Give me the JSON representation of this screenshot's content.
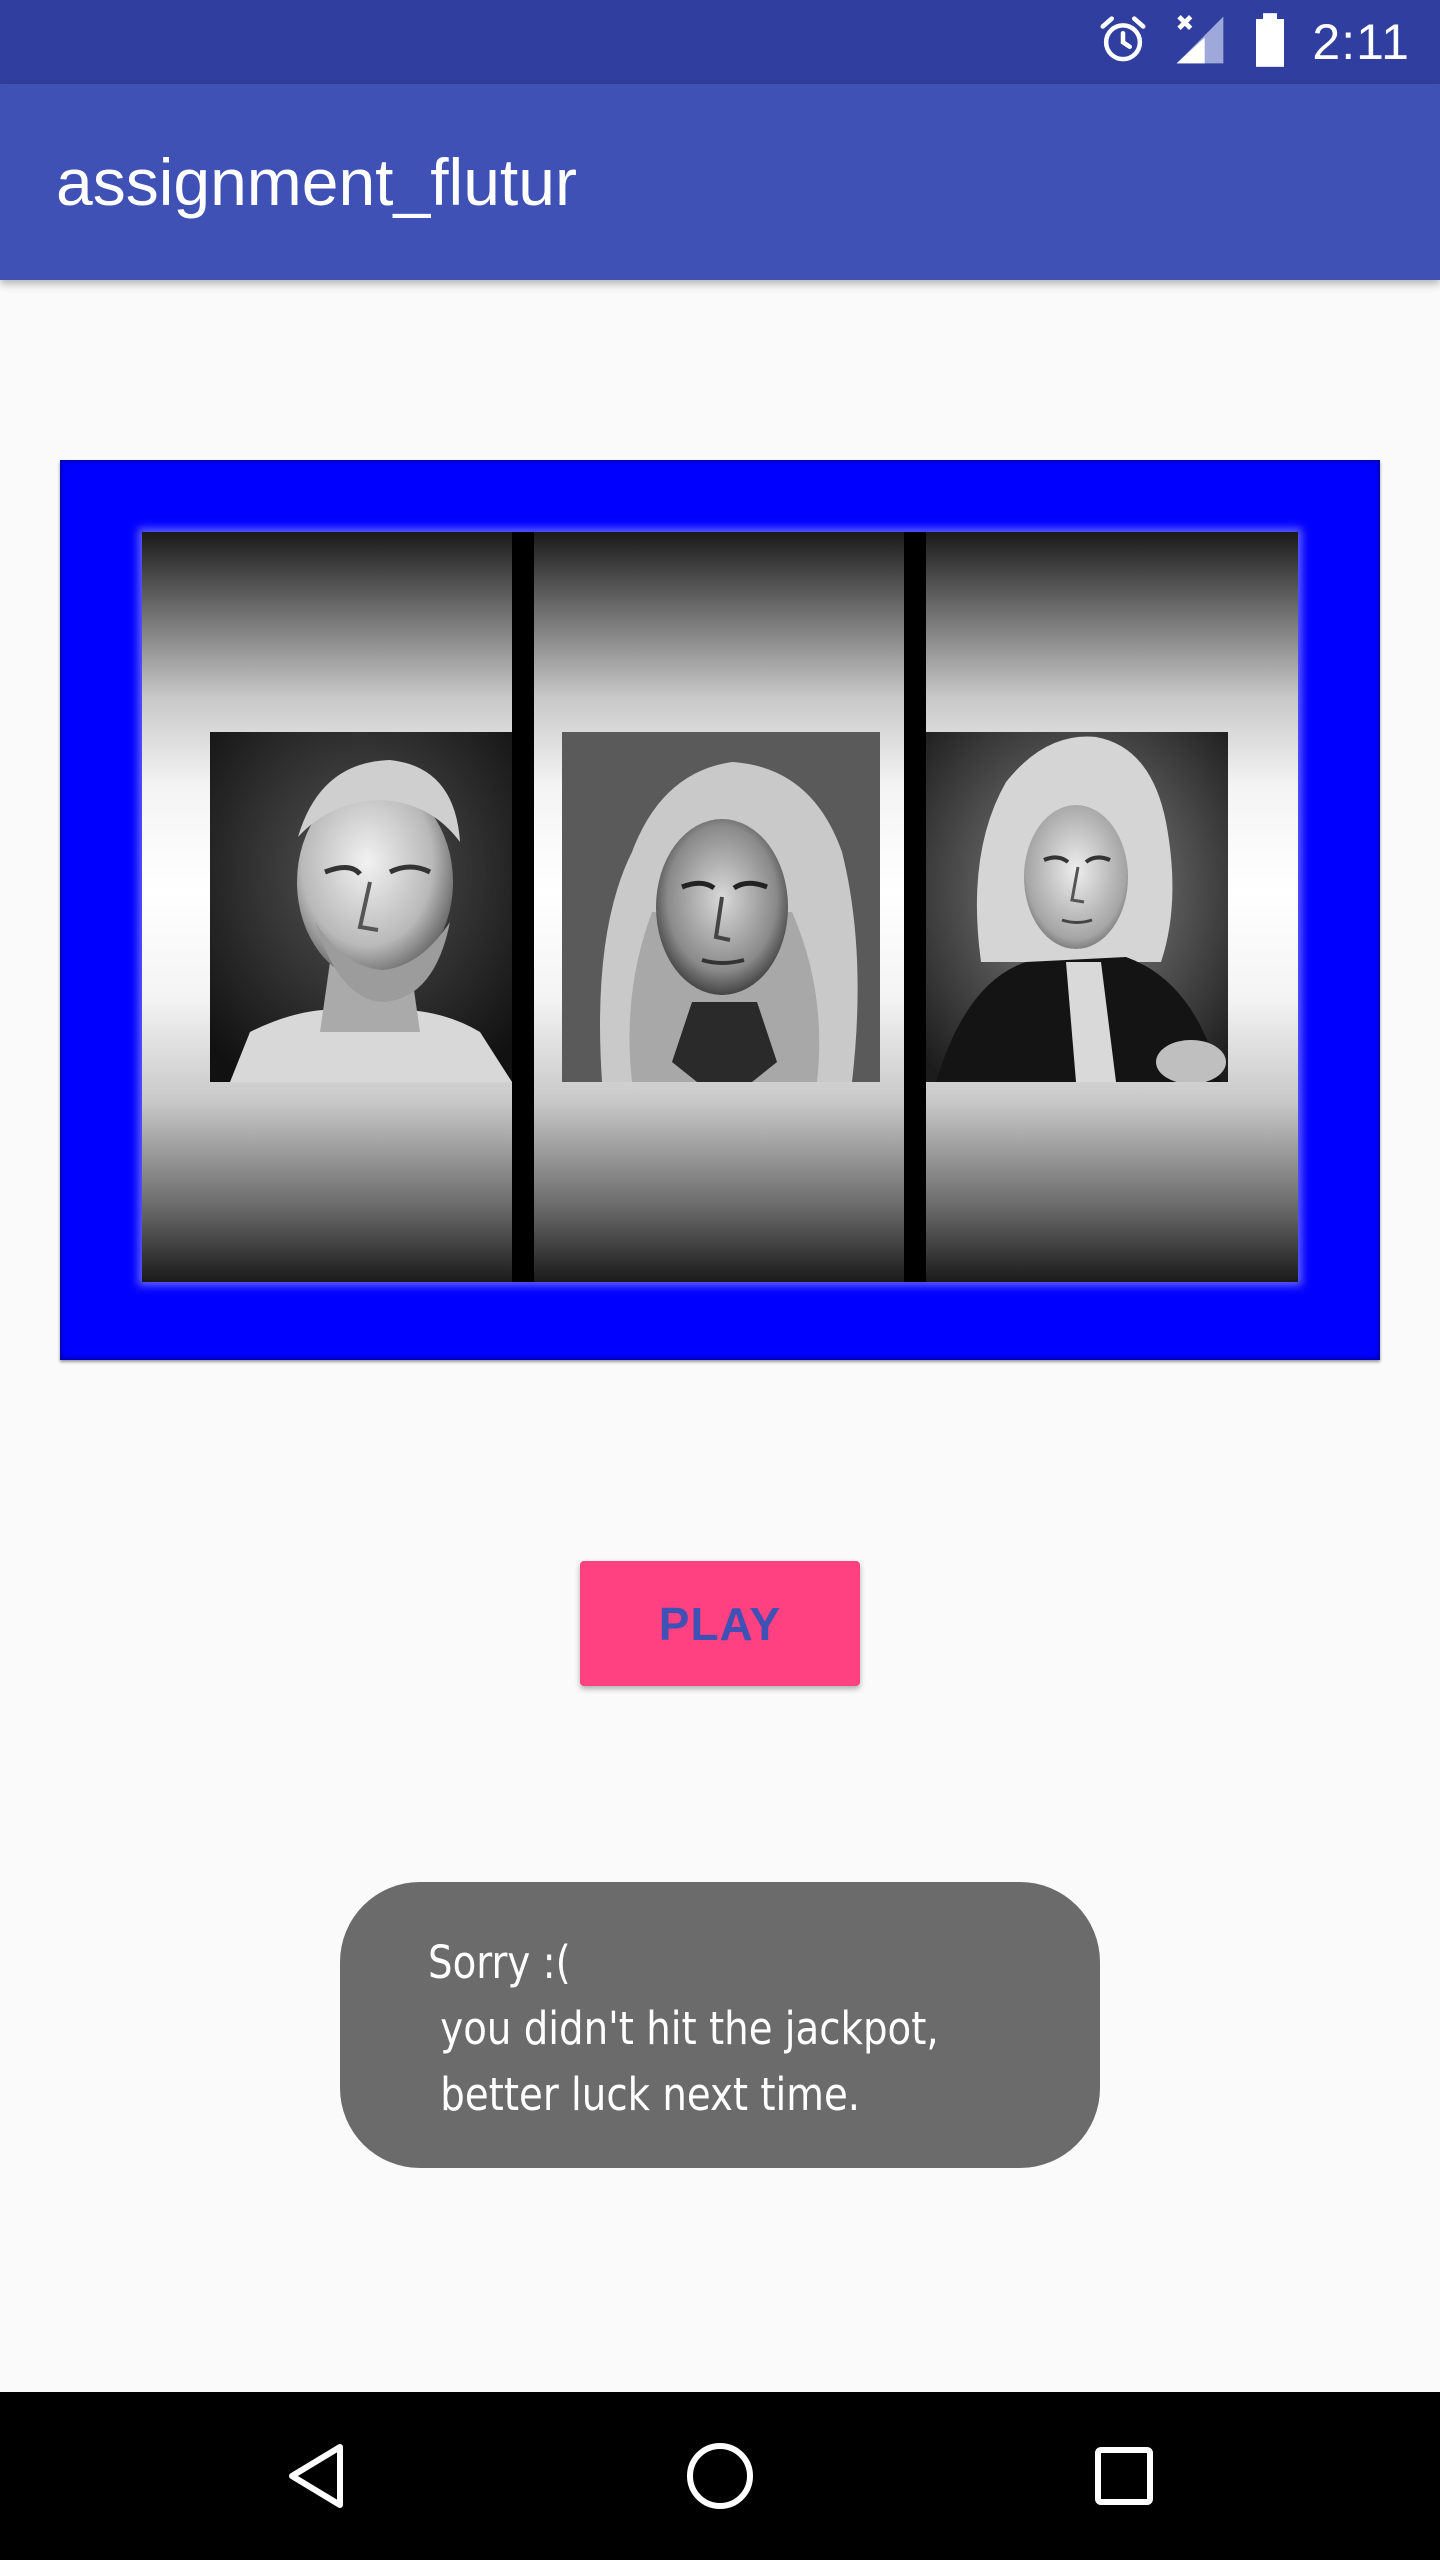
{
  "status_bar": {
    "time": "2:11",
    "icons": [
      "alarm-icon",
      "signal-no-data-icon",
      "battery-icon"
    ]
  },
  "app_bar": {
    "title": "assignment_flutur",
    "color": "#3f51b5",
    "status_color": "#303f9f"
  },
  "slot_machine": {
    "frame_color": "#0000ff",
    "reels": [
      {
        "icon": "hannibal-bust-portrait"
      },
      {
        "icon": "isaac-newton-portrait"
      },
      {
        "icon": "alexander-pope-portrait"
      }
    ]
  },
  "play_button": {
    "label": "PLAY",
    "background": "#ff4081",
    "text_color": "#3f51b5"
  },
  "toast": {
    "message": "Sorry :(\n you didn't hit the jackpot,\n better luck next time."
  },
  "nav_bar": {
    "buttons": [
      "back-icon",
      "home-icon",
      "recents-icon"
    ]
  }
}
